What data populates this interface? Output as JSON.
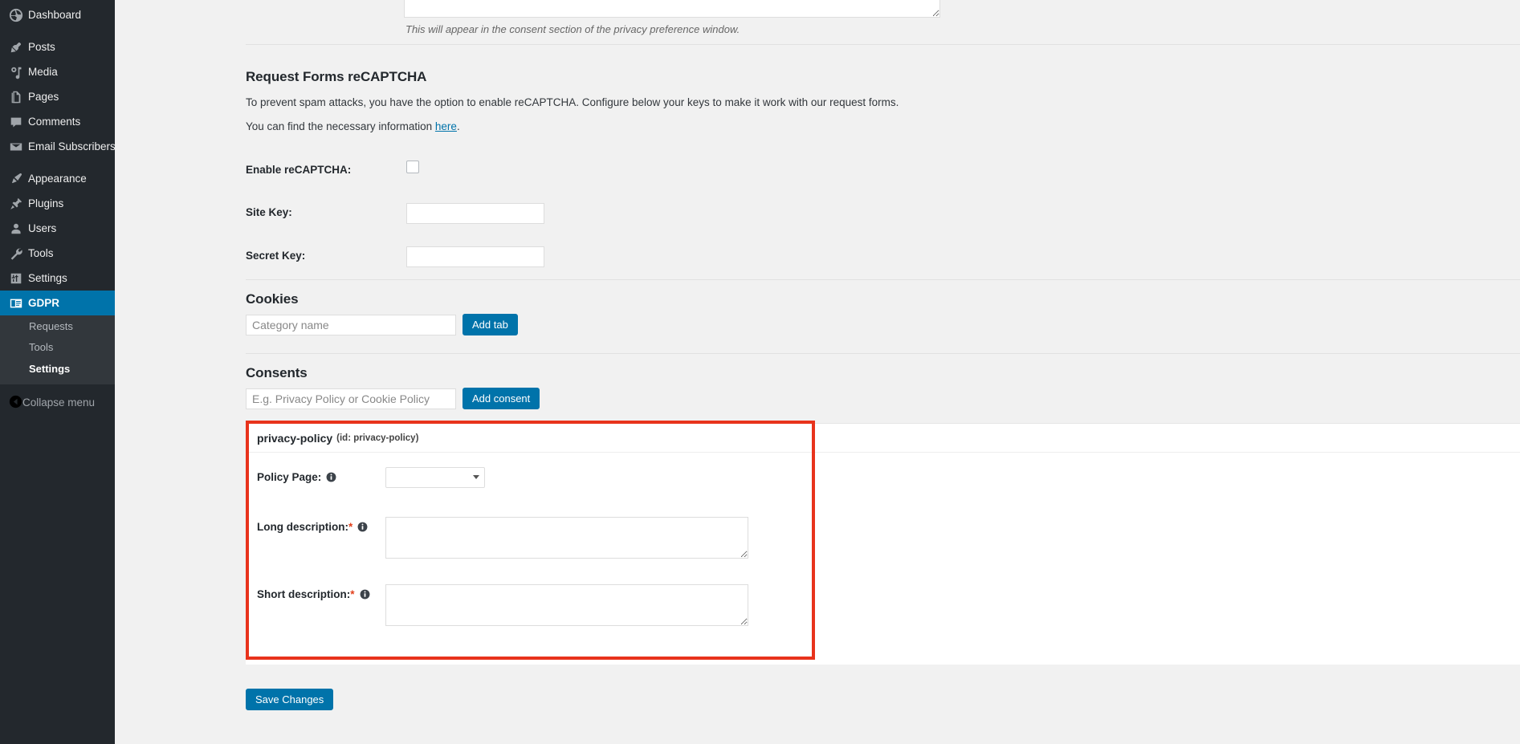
{
  "sidebar": {
    "items": [
      {
        "label": "Dashboard",
        "icon": "dashboard-icon",
        "current": false
      },
      {
        "label": "Posts",
        "icon": "pin-icon",
        "current": false
      },
      {
        "label": "Media",
        "icon": "media-icon",
        "current": false
      },
      {
        "label": "Pages",
        "icon": "page-icon",
        "current": false
      },
      {
        "label": "Comments",
        "icon": "comment-icon",
        "current": false
      },
      {
        "label": "Email Subscribers",
        "icon": "envelope-icon",
        "current": false
      },
      {
        "label": "Appearance",
        "icon": "brush-icon",
        "current": false
      },
      {
        "label": "Plugins",
        "icon": "plug-icon",
        "current": false
      },
      {
        "label": "Users",
        "icon": "user-icon",
        "current": false
      },
      {
        "label": "Tools",
        "icon": "wrench-icon",
        "current": false
      },
      {
        "label": "Settings",
        "icon": "sliders-icon",
        "current": false
      },
      {
        "label": "GDPR",
        "icon": "id-card-icon",
        "current": true
      }
    ],
    "submenu": [
      {
        "label": "Requests",
        "current": false
      },
      {
        "label": "Tools",
        "current": false
      },
      {
        "label": "Settings",
        "current": true
      }
    ],
    "collapse": {
      "label": "Collapse menu",
      "icon": "collapse-arrow-icon"
    },
    "accent_color": "#0073aa",
    "background_color": "#23282d",
    "submenu_background_color": "#32373c"
  },
  "main": {
    "consent_textarea_value": "",
    "consent_textarea_help": "This will appear in the consent section of the privacy preference window.",
    "recaptcha": {
      "heading": "Request Forms reCAPTCHA",
      "description": "To prevent spam attacks, you have the option to enable reCAPTCHA. Configure below your keys to make it work with our request forms.",
      "info_prefix": "You can find the necessary information ",
      "info_link": "here",
      "info_suffix": ".",
      "enable_label": "Enable reCAPTCHA:",
      "enable_checked": false,
      "site_key_label": "Site Key:",
      "site_key_value": "",
      "secret_key_label": "Secret Key:",
      "secret_key_value": ""
    },
    "cookies": {
      "heading": "Cookies",
      "input_placeholder": "Category name",
      "input_value": "",
      "add_button": "Add tab"
    },
    "consents": {
      "heading": "Consents",
      "input_placeholder": "E.g. Privacy Policy or Cookie Policy",
      "input_value": "",
      "add_button": "Add consent",
      "panel": {
        "title": "privacy-policy",
        "id_text": "(id: privacy-policy)",
        "close_icon": "close-circle-icon",
        "policy_page_label": "Policy Page:",
        "policy_page_value": "",
        "long_description_label": "Long description:",
        "long_description_required": "*",
        "long_description_value": "",
        "short_description_label": "Short description:",
        "short_description_required": "*",
        "short_description_value": "",
        "highlight_color": "#e8331c"
      }
    },
    "save_button": "Save Changes"
  }
}
